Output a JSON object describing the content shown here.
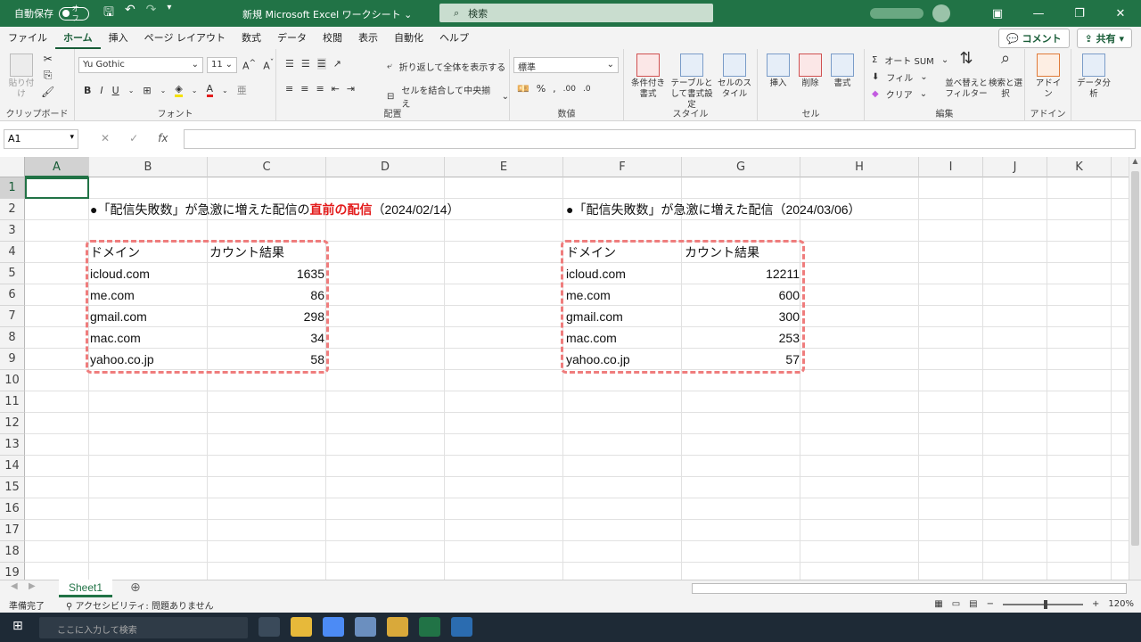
{
  "titlebar": {
    "autosave_label": "自動保存",
    "autosave_state": "オフ",
    "doc_title": "新規 Microsoft Excel ワークシート ⌄",
    "search_placeholder": "検索"
  },
  "tabs": [
    "ファイル",
    "ホーム",
    "挿入",
    "ページ レイアウト",
    "数式",
    "データ",
    "校閲",
    "表示",
    "自動化",
    "ヘルプ"
  ],
  "active_tab": "ホーム",
  "tab_buttons": {
    "comment": "コメント",
    "share": "共有"
  },
  "ribbon": {
    "clipboard": {
      "paste": "貼り付け",
      "label": "クリップボード"
    },
    "font": {
      "name": "Yu Gothic",
      "size": "11",
      "label": "フォント"
    },
    "alignment": {
      "wrap": "折り返して全体を表示する",
      "merge": "セルを結合して中央揃え",
      "label": "配置"
    },
    "number": {
      "format": "標準",
      "label": "数値"
    },
    "styles": {
      "cond": "条件付き書式",
      "table": "テーブルとして書式設定",
      "cell": "セルのスタイル",
      "label": "スタイル"
    },
    "cells": {
      "insert": "挿入",
      "delete": "削除",
      "format": "書式",
      "label": "セル"
    },
    "editing": {
      "autosum": "オート SUM",
      "fill": "フィル",
      "clear": "クリア",
      "sort": "並べ替えとフィルター",
      "find": "検索と選択",
      "label": "編集"
    },
    "addins": {
      "addin": "アドイン",
      "label": "アドイン"
    },
    "analysis": {
      "data": "データ分析"
    }
  },
  "formula_bar": {
    "namebox": "A1",
    "fx": "fx",
    "formula": ""
  },
  "columns": [
    "A",
    "B",
    "C",
    "D",
    "E",
    "F",
    "G",
    "H",
    "I",
    "J",
    "K"
  ],
  "rows": [
    "1",
    "2",
    "3",
    "4",
    "5",
    "6",
    "7",
    "8",
    "9",
    "10",
    "11",
    "12",
    "13",
    "14",
    "15",
    "16",
    "17",
    "18",
    "19"
  ],
  "sheet": {
    "left_title_pre": "●「配信失敗数」が急激に増えた配信の",
    "left_title_red": "直前の配信",
    "left_title_post": "（2024/02/14）",
    "right_title": "●「配信失敗数」が急激に増えた配信（2024/03/06）",
    "header_domain": "ドメイン",
    "header_count": "カウント結果",
    "left_table": [
      {
        "domain": "icloud.com",
        "count": "1635"
      },
      {
        "domain": "me.com",
        "count": "86"
      },
      {
        "domain": "gmail.com",
        "count": "298"
      },
      {
        "domain": "mac.com",
        "count": "34"
      },
      {
        "domain": "yahoo.co.jp",
        "count": "58"
      }
    ],
    "right_table": [
      {
        "domain": "icloud.com",
        "count": "12211"
      },
      {
        "domain": "me.com",
        "count": "600"
      },
      {
        "domain": "gmail.com",
        "count": "300"
      },
      {
        "domain": "mac.com",
        "count": "253"
      },
      {
        "domain": "yahoo.co.jp",
        "count": "57"
      }
    ]
  },
  "sheet_tabs": [
    "Sheet1"
  ],
  "status": {
    "ready": "準備完了",
    "accessibility": "アクセシビリティ: 問題ありません",
    "zoom": "120%"
  },
  "taskbar": {
    "search_placeholder": "ここに入力して検索"
  }
}
